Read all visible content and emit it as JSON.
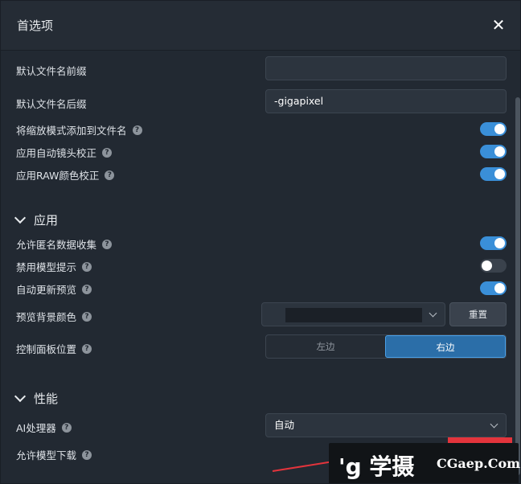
{
  "dialog": {
    "title": "首选项",
    "close_glyph": "✕"
  },
  "naming": {
    "prefix_label": "默认文件名前缀",
    "prefix_value": "",
    "suffix_label": "默认文件名后缀",
    "suffix_value": "-gigapixel",
    "add_scale_label": "将缩放模式添加到文件名",
    "add_scale_on": true,
    "lens_label": "应用自动镜头校正",
    "lens_on": true,
    "raw_label": "应用RAW颜色校正",
    "raw_on": true
  },
  "app_section": {
    "title": "应用",
    "anon_label": "允许匿名数据收集",
    "anon_on": true,
    "hints_label": "禁用模型提示",
    "hints_on": false,
    "preview_label": "自动更新预览",
    "preview_on": true,
    "bg_color_label": "预览背景颜色",
    "bg_color_value": "#1b2027",
    "reset_label": "重置",
    "panel_label": "控制面板位置",
    "panel_left": "左边",
    "panel_right": "右边",
    "panel_selected": "右边"
  },
  "perf_section": {
    "title": "性能",
    "ai_label": "AI处理器",
    "ai_value": "自动",
    "download_label": "允许模型下载"
  },
  "help_glyph": "?",
  "watermark": {
    "logo": "'g 学摄",
    "text": "CGaep.Com"
  },
  "colors": {
    "accent": "#3a8fd8",
    "background": "#222932",
    "red": "#e3343c"
  }
}
